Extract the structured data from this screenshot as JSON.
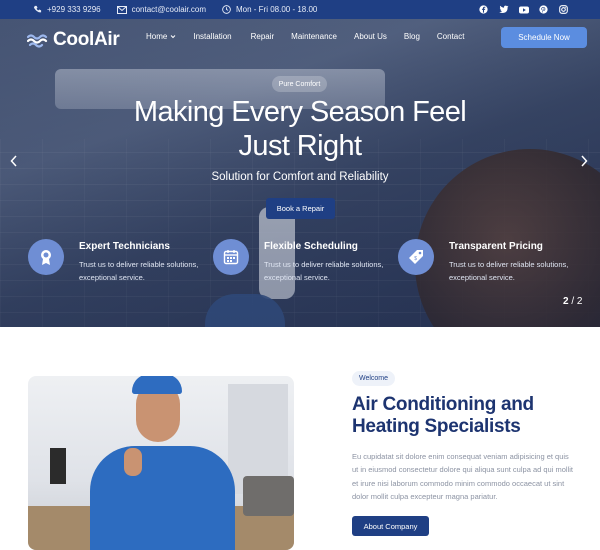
{
  "topbar": {
    "phone": "+929 333 9296",
    "email": "contact@coolair.com",
    "hours": "Mon - Fri 08.00 - 18.00",
    "social_icons": [
      "facebook-icon",
      "twitter-icon",
      "youtube-icon",
      "pinterest-icon",
      "instagram-icon"
    ]
  },
  "header": {
    "logo_text": "CoolAir",
    "nav": [
      {
        "label": "Home",
        "has_dropdown": true
      },
      {
        "label": "Installation"
      },
      {
        "label": "Repair"
      },
      {
        "label": "Maintenance"
      },
      {
        "label": "About Us"
      },
      {
        "label": "Blog"
      },
      {
        "label": "Contact"
      }
    ],
    "cta_label": "Schedule Now"
  },
  "hero": {
    "pill": "Pure Comfort",
    "title_line1": "Making Every Season Feel",
    "title_line2": "Just Right",
    "subtitle": "Solution for Comfort and Reliability",
    "button_label": "Book a Repair",
    "features": [
      {
        "title": "Expert Technicians",
        "text": "Trust us to deliver reliable solutions, exceptional service.",
        "icon": "medal-icon"
      },
      {
        "title": "Flexible Scheduling",
        "text": "Trust us to deliver reliable solutions, exceptional service.",
        "icon": "calendar-icon"
      },
      {
        "title": "Transparent Pricing",
        "text": "Trust us to deliver reliable solutions, exceptional service.",
        "icon": "price-tag-icon"
      }
    ],
    "pager_current": "2",
    "pager_separator": "/",
    "pager_total": "2"
  },
  "about": {
    "badge": "Welcome",
    "title": "Air Conditioning and Heating Specialists",
    "text": "Eu cupidatat sit dolore enim consequat veniam adipisicing et quis ut in eiusmod consectetur dolore qui aliqua sunt culpa ad qui mollit et irure nisi laborum commodo minim commodo occaecat ut sint dolor mollit culpa excepteur magna pariatur.",
    "button_label": "About Company"
  },
  "colors": {
    "brand_dark": "#1f3f84",
    "accent": "#5b8de0",
    "heading": "#1d3470",
    "muted_text": "#8c93a3"
  }
}
